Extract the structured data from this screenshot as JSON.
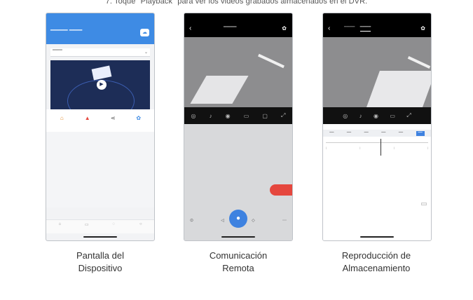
{
  "instruction": "7. Toque \"Playback\" para ver los videos grabados almacenados en el DVR.",
  "captions": [
    {
      "line1": "Pantalla del",
      "line2": "Dispositivo"
    },
    {
      "line1": "Comunicación",
      "line2": "Remota"
    },
    {
      "line1": "Reproducción de",
      "line2": "Almacenamiento"
    }
  ],
  "colors": {
    "accent": "#3e8be4",
    "record": "#e5473e",
    "text": "#333333"
  },
  "icons": {
    "back": "chevron-left-icon",
    "settings": "gear-icon",
    "play": "play-icon",
    "mic": "microphone-icon"
  }
}
